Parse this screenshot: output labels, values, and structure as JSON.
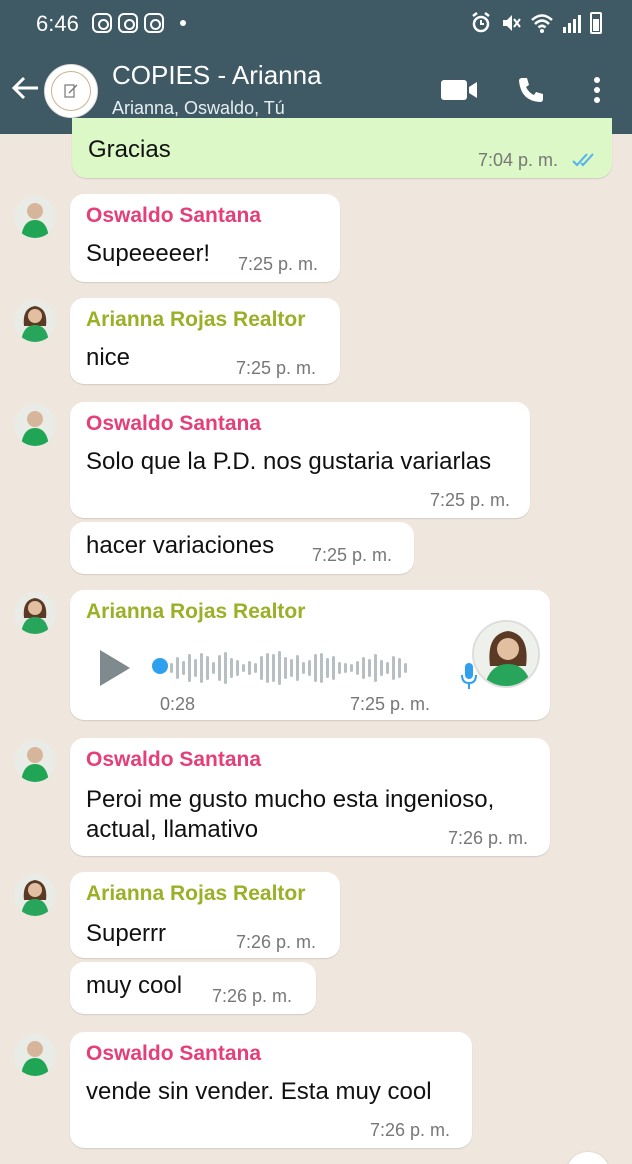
{
  "status_bar": {
    "time": "6:46"
  },
  "header": {
    "title": "COPIES - Arianna",
    "subtitle": "Arianna, Oswaldo, Tú"
  },
  "messages": [
    {
      "type": "outgoing",
      "text": "Gracias",
      "time": "7:04 p. m.",
      "status": "read"
    },
    {
      "sender": "Oswaldo Santana",
      "text": "Supeeeeer!",
      "time": "7:25 p. m."
    },
    {
      "sender": "Arianna Rojas Realtor",
      "text": "nice",
      "time": "7:25 p. m."
    },
    {
      "sender": "Oswaldo Santana",
      "text": "Solo que la P.D. nos gustaria variarlas",
      "time": "7:25 p. m."
    },
    {
      "text": "hacer variaciones",
      "time": "7:25 p. m."
    },
    {
      "sender": "Arianna Rojas Realtor",
      "type": "audio",
      "duration": "0:28",
      "time": "7:25 p. m.",
      "progress": 0
    },
    {
      "sender": "Oswaldo Santana",
      "text_line1": "Peroi me gusto mucho esta ingenioso,",
      "text_line2": "actual, llamativo",
      "time": "7:26 p. m."
    },
    {
      "sender": "Arianna Rojas Realtor",
      "text": "Superrr",
      "time": "7:26 p. m."
    },
    {
      "text": "muy cool",
      "time": "7:26 p. m."
    },
    {
      "sender": "Oswaldo Santana",
      "text": "vende sin vender. Esta muy cool",
      "time": "7:26 p. m."
    }
  ],
  "colors": {
    "header_bg": "#3f5a64",
    "chat_bg": "#efe7dd",
    "outgoing_bubble": "#dcf8c6",
    "sender_oswaldo": "#e53e78",
    "sender_arianna": "#9bb026",
    "read_ticks": "#4fb4ec"
  },
  "icons": {
    "back": "arrow-left-icon",
    "video": "video-call-icon",
    "call": "phone-icon",
    "menu": "more-vert-icon",
    "play": "play-icon",
    "mic": "microphone-icon"
  }
}
